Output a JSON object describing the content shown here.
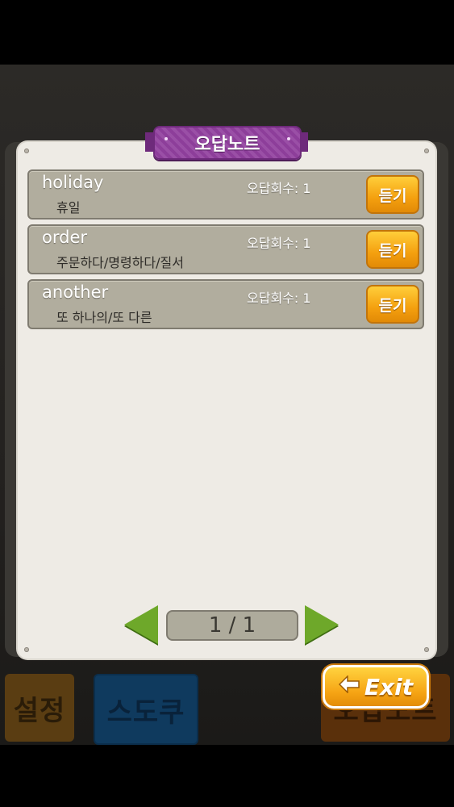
{
  "title": "오답노트",
  "items": [
    {
      "word": "holiday",
      "meaning": "휴일",
      "count_label": "오답회수: 1",
      "listen_label": "듣기"
    },
    {
      "word": "order",
      "meaning": "주문하다/명령하다/질서",
      "count_label": "오답회수: 1",
      "listen_label": "듣기"
    },
    {
      "word": "another",
      "meaning": "또 하나의/또 다른",
      "count_label": "오답회수: 1",
      "listen_label": "듣기"
    }
  ],
  "pagination": {
    "label": "1 / 1"
  },
  "exit_label": "Exit",
  "bottom_menu": {
    "settings": "설정",
    "sudoku": "스도쿠",
    "wrong_note": "오답노트"
  },
  "icons": {
    "exit": "left-arrow-icon",
    "prev": "prev-arrow-icon",
    "next": "next-arrow-icon"
  },
  "colors": {
    "accent_purple": "#9a4fa6",
    "button_orange": "#f4a00f",
    "arrow_green": "#6ea82a"
  }
}
